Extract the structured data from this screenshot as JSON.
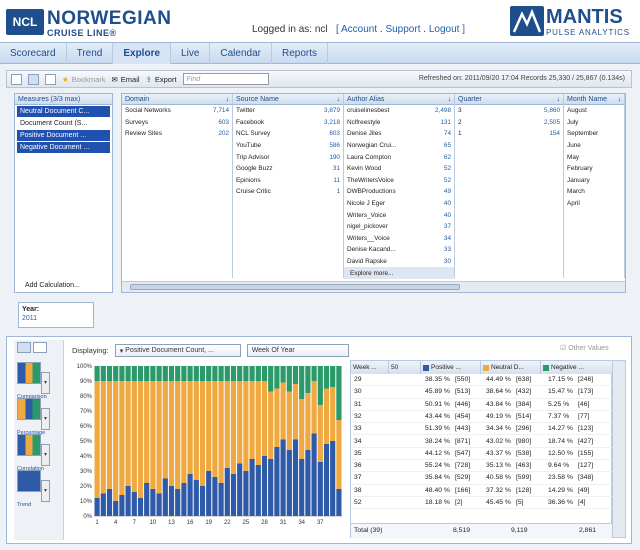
{
  "brand": {
    "ncl_box": "NCL",
    "name": "NORWEGIAN",
    "subtitle": "CRUISE LINE®",
    "mantis": "MANTIS",
    "mantis_sub": "PULSE ANALYTICS"
  },
  "login": {
    "text": "Logged in as: ncl",
    "account": "[ Account",
    "support": "Support",
    "logout": "Logout ]"
  },
  "nav": [
    "Scorecard",
    "Trend",
    "Explore",
    "Live",
    "Calendar",
    "Reports"
  ],
  "toolbar": {
    "bookmark": "Bookmark",
    "email": "Email",
    "export": "Export",
    "find_placeholder": "Find",
    "refreshed": "Refreshed on: 2011/09/20 17:04  Records 25,330 / 25,867 (0.134s)"
  },
  "measures": {
    "title": "Measures (3/3 max)",
    "items": [
      {
        "label": "Neutral Document C...",
        "on": true
      },
      {
        "label": "Document Count (S...",
        "on": false
      },
      {
        "label": "Positive Document ...",
        "on": true
      },
      {
        "label": "Negative Document ...",
        "on": true
      }
    ],
    "add": "Add Calculation..."
  },
  "dims": [
    {
      "title": "Domain",
      "rows": [
        [
          "Social Networks",
          "7,714"
        ],
        [
          "Surveys",
          "603"
        ],
        [
          "Review Sites",
          "202"
        ]
      ]
    },
    {
      "title": "Source Name",
      "rows": [
        [
          "Twitter",
          "3,879"
        ],
        [
          "Facebook",
          "3,218"
        ],
        [
          "NCL Survey",
          "603"
        ],
        [
          "YouTube",
          "586"
        ],
        [
          "Trip Advisor",
          "190"
        ],
        [
          "Google Buzz",
          "31"
        ],
        [
          "Epinions",
          "11"
        ],
        [
          "Cruise Critic",
          "1"
        ]
      ]
    },
    {
      "title": "Author Alias",
      "rows": [
        [
          "cruiselinesbest",
          "2,498"
        ],
        [
          "Nclfreestyle",
          "131"
        ],
        [
          "Denise Jiles",
          "74"
        ],
        [
          "Norwegian Crui...",
          "65"
        ],
        [
          "Laura Compton",
          "62"
        ],
        [
          "Kevin Wood",
          "52"
        ],
        [
          "TheWritersVoice",
          "52"
        ],
        [
          "DWBProductions",
          "49"
        ],
        [
          "Nicole J Eger",
          "40"
        ],
        [
          "Writers_Voice",
          "40"
        ],
        [
          "nigel_pickover",
          "37"
        ],
        [
          "Writers__Voice",
          "34"
        ],
        [
          "Denise Kacand...",
          "33"
        ],
        [
          "David Rapske",
          "30"
        ],
        [
          "Explore more...",
          ""
        ]
      ]
    },
    {
      "title": "Quarter",
      "rows": [
        [
          "3",
          "5,860"
        ],
        [
          "2",
          "2,505"
        ],
        [
          "1",
          "154"
        ]
      ]
    },
    {
      "title": "Month Name",
      "rows": [
        [
          "August",
          ""
        ],
        [
          "July",
          ""
        ],
        [
          "September",
          ""
        ],
        [
          "June",
          ""
        ],
        [
          "May",
          ""
        ],
        [
          "February",
          ""
        ],
        [
          "January",
          ""
        ],
        [
          "March",
          ""
        ],
        [
          "April",
          ""
        ]
      ]
    }
  ],
  "year": {
    "label": "Year:",
    "value": "2011"
  },
  "views": [
    "Comparison",
    "Percentage",
    "Correlation",
    "Trend"
  ],
  "display": {
    "label": "Displaying:",
    "measure": "Positive Document Count, ...",
    "period": "Week Of Year",
    "other": "Other Values"
  },
  "colors": {
    "positive": "#2e5aa8",
    "neutral": "#f0a840",
    "negative": "#2a9a6a"
  },
  "chart_data": {
    "type": "bar",
    "stacked": true,
    "ylim": [
      0,
      100
    ],
    "yticks": [
      "0%",
      "10%",
      "20%",
      "30%",
      "40%",
      "50%",
      "60%",
      "70%",
      "80%",
      "90%",
      "100%"
    ],
    "x": [
      1,
      2,
      3,
      4,
      5,
      6,
      7,
      8,
      9,
      10,
      11,
      12,
      13,
      14,
      15,
      16,
      17,
      18,
      19,
      20,
      21,
      22,
      23,
      24,
      25,
      26,
      27,
      28,
      29,
      30,
      31,
      32,
      33,
      34,
      35,
      36,
      37,
      38,
      39,
      40
    ],
    "xticks": [
      "1",
      "4",
      "7",
      "10",
      "13",
      "16",
      "19",
      "22",
      "25",
      "28",
      "31",
      "34",
      "37"
    ],
    "series": [
      {
        "name": "Positive Document Count",
        "values": [
          12,
          15,
          18,
          10,
          14,
          20,
          16,
          12,
          22,
          18,
          15,
          25,
          20,
          18,
          22,
          28,
          24,
          20,
          30,
          26,
          22,
          32,
          28,
          35,
          30,
          38,
          34,
          40,
          38,
          46,
          51,
          44,
          51,
          38,
          44,
          55,
          36,
          48,
          50,
          18
        ]
      },
      {
        "name": "Neutral Document Count",
        "values": [
          78,
          75,
          72,
          80,
          76,
          70,
          74,
          78,
          68,
          72,
          75,
          65,
          70,
          72,
          68,
          62,
          66,
          70,
          60,
          64,
          68,
          58,
          62,
          55,
          60,
          52,
          56,
          50,
          45,
          39,
          38,
          39,
          37,
          40,
          38,
          35,
          38,
          37,
          36,
          46
        ]
      },
      {
        "name": "Negative Document Count",
        "values": [
          10,
          10,
          10,
          10,
          10,
          10,
          10,
          10,
          10,
          10,
          10,
          10,
          10,
          10,
          10,
          10,
          10,
          10,
          10,
          10,
          10,
          10,
          10,
          10,
          10,
          10,
          10,
          10,
          17,
          15,
          11,
          17,
          12,
          22,
          18,
          10,
          26,
          15,
          14,
          36
        ]
      }
    ]
  },
  "table": {
    "headers": [
      "Week ...",
      "50",
      "Positive ...",
      "Neutral D...",
      "Negative ..."
    ],
    "rows": [
      [
        "29",
        "38.35 %",
        "[550]",
        "44.49 %",
        "[638]",
        "17.15 %",
        "[246]"
      ],
      [
        "30",
        "45.89 %",
        "[513]",
        "38.64 %",
        "[432]",
        "15.47 %",
        "[173]"
      ],
      [
        "31",
        "50.91 %",
        "[446]",
        "43.84 %",
        "[384]",
        "5.25 %",
        "[46]"
      ],
      [
        "32",
        "43.44 %",
        "[454]",
        "49.19 %",
        "[514]",
        "7.37 %",
        "[77]"
      ],
      [
        "33",
        "51.39 %",
        "[443]",
        "34.34 %",
        "[296]",
        "14.27 %",
        "[123]"
      ],
      [
        "34",
        "38.24 %",
        "[871]",
        "43.02 %",
        "[980]",
        "18.74 %",
        "[427]"
      ],
      [
        "35",
        "44.12 %",
        "[547]",
        "43.37 %",
        "[538]",
        "12.50 %",
        "[155]"
      ],
      [
        "36",
        "55.24 %",
        "[728]",
        "35.13 %",
        "[463]",
        "9.64 %",
        "[127]"
      ],
      [
        "37",
        "35.84 %",
        "[529]",
        "40.58 %",
        "[599]",
        "23.58 %",
        "[348]"
      ],
      [
        "38",
        "48.40 %",
        "[166]",
        "37.32 %",
        "[128]",
        "14.29 %",
        "[49]"
      ],
      [
        "52",
        "18.18 %",
        "[2]",
        "45.45 %",
        "[5]",
        "36.36 %",
        "[4]"
      ]
    ],
    "total": [
      "Total (39)",
      "8,519",
      "9,119",
      "2,861"
    ]
  }
}
